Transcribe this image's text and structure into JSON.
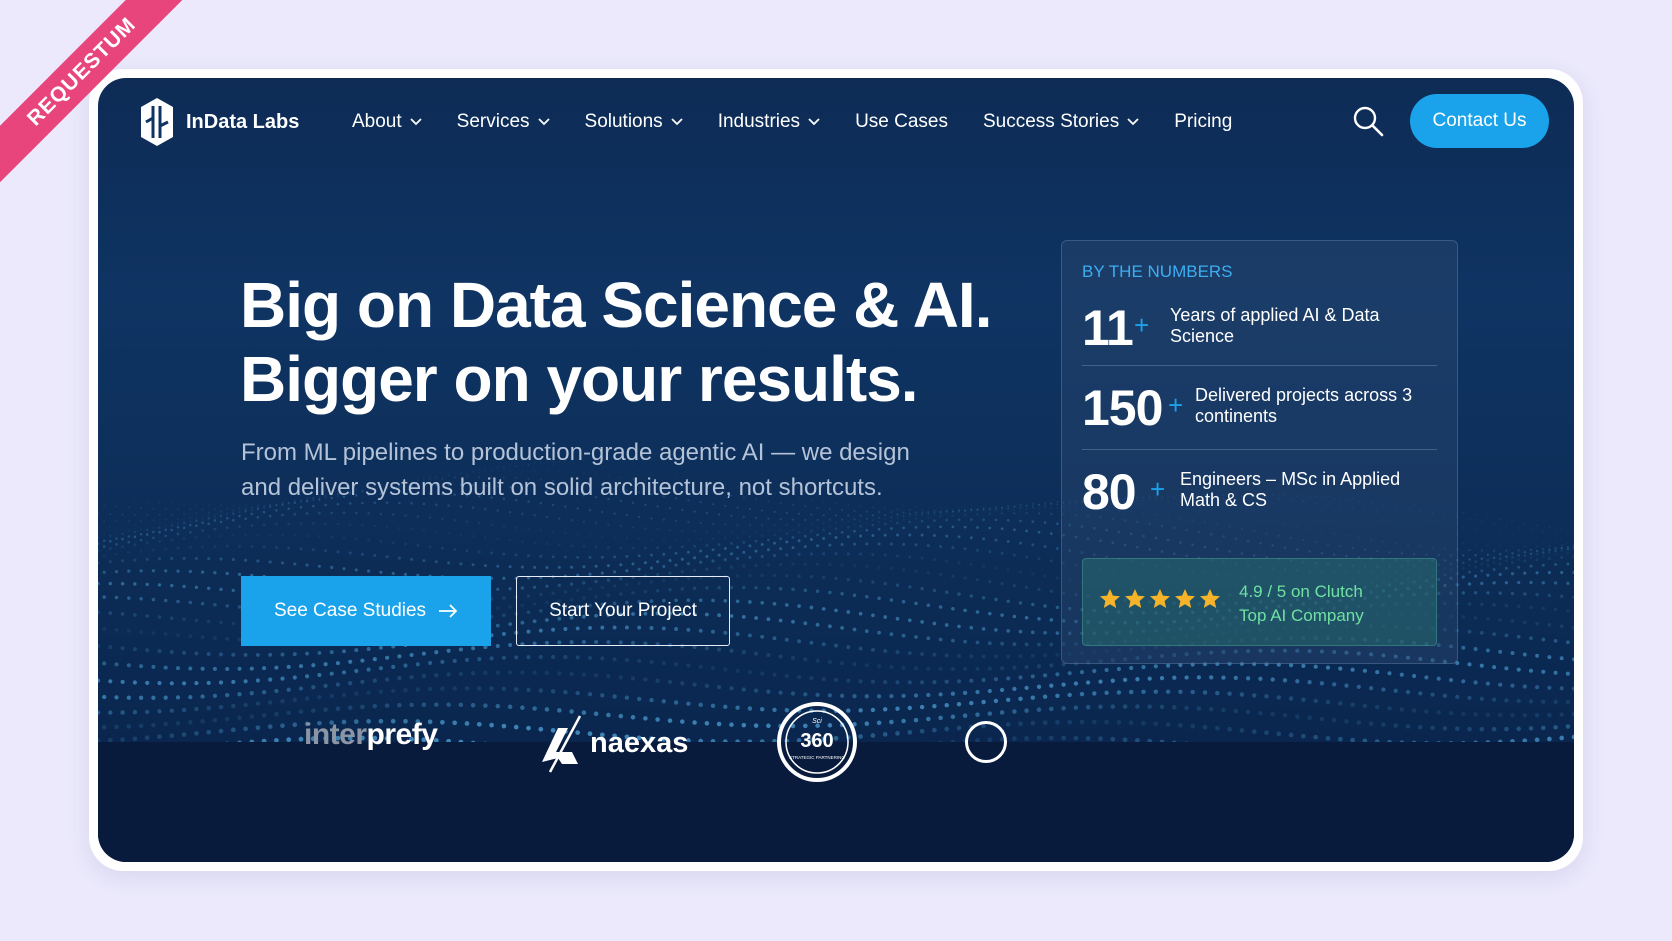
{
  "ribbon": {
    "text": "REQUESTUM"
  },
  "nav": {
    "brand": "InData Labs",
    "items": [
      {
        "label": "About",
        "dropdown": true
      },
      {
        "label": "Services",
        "dropdown": true
      },
      {
        "label": "Solutions",
        "dropdown": true
      },
      {
        "label": "Industries",
        "dropdown": true
      },
      {
        "label": "Use Cases",
        "dropdown": false
      },
      {
        "label": "Success Stories",
        "dropdown": true
      },
      {
        "label": "Pricing",
        "dropdown": false
      }
    ],
    "contact_label": "Contact Us"
  },
  "hero": {
    "headline_line1": "Big on Data Science & AI.",
    "headline_line2": "Bigger on your results.",
    "subtext": "From ML pipelines to production-grade agentic AI — we design and deliver systems built on solid architecture, not shortcuts.",
    "primary_cta": "See Case Studies",
    "secondary_cta": "Start Your Project"
  },
  "stats": {
    "label": "BY THE NUMBERS",
    "items": [
      {
        "value": "11",
        "plus": "+",
        "desc": "Years of applied AI & Data Science"
      },
      {
        "value": "150",
        "plus": "+",
        "desc": "Delivered projects across 3 continents"
      },
      {
        "value": "80",
        "plus": "+",
        "desc": "Engineers – MSc in Applied Math & CS"
      }
    ],
    "clutch": {
      "rating_line": "4.9 / 5 on Clutch",
      "award_line": "Top AI Company",
      "stars": 5
    }
  },
  "partners": {
    "interprefy_a": "inter",
    "interprefy_b": "prefy",
    "naexas": "naexas",
    "sci360": "360",
    "sci360_top": "Sci",
    "sci360_bottom": "STRATEGIC PARTNERING"
  },
  "colors": {
    "accent": "#1aa3ea",
    "navy": "#0d2b55",
    "clutch_green": "#6fe0a2",
    "star": "#f5b32a",
    "ribbon": "#e8457d"
  }
}
